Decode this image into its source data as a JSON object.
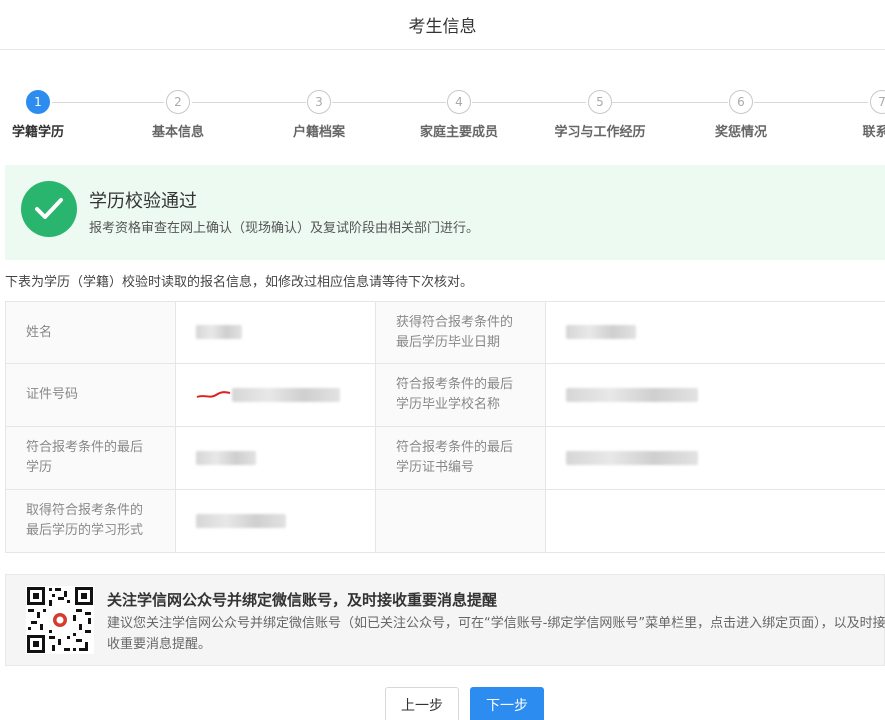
{
  "header": {
    "title": "考生信息"
  },
  "steps": [
    {
      "num": "1",
      "label": "学籍学历",
      "active": true
    },
    {
      "num": "2",
      "label": "基本信息",
      "active": false
    },
    {
      "num": "3",
      "label": "户籍档案",
      "active": false
    },
    {
      "num": "4",
      "label": "家庭主要成员",
      "active": false
    },
    {
      "num": "5",
      "label": "学习与工作经历",
      "active": false
    },
    {
      "num": "6",
      "label": "奖惩情况",
      "active": false
    },
    {
      "num": "7",
      "label": "联系方",
      "active": false
    }
  ],
  "success": {
    "title": "学历校验通过",
    "desc": "报考资格审查在网上确认（现场确认）及复试阶段由相关部门进行。"
  },
  "note": "下表为学历（学籍）校验时读取的报名信息，如修改过相应信息请等待下次核对。",
  "table": {
    "name_label": "姓名",
    "grad_date_label_1": "获得符合报考条件的",
    "grad_date_label_2": "最后学历毕业日期",
    "id_label": "证件号码",
    "school_label_1": "符合报考条件的最后",
    "school_label_2": "学历毕业学校名称",
    "edu_label_1": "符合报考条件的最后",
    "edu_label_2": "学历",
    "cert_label_1": "符合报考条件的最后",
    "cert_label_2": "学历证书编号",
    "form_label_1": "取得符合报考条件的",
    "form_label_2": "最后学历的学习形式"
  },
  "wechat": {
    "title": "关注学信网公众号并绑定微信账号，及时接收重要消息提醒",
    "desc": "建议您关注学信网公众号并绑定微信账号（如已关注公众号，可在“学信账号-绑定学信网账号”菜单栏里，点击进入绑定页面），以及时接收重要消息提醒。"
  },
  "buttons": {
    "prev": "上一步",
    "next": "下一步"
  },
  "colors": {
    "accent": "#2d8cf0",
    "success": "#2ab56e",
    "success_bg": "#edfaf1"
  }
}
